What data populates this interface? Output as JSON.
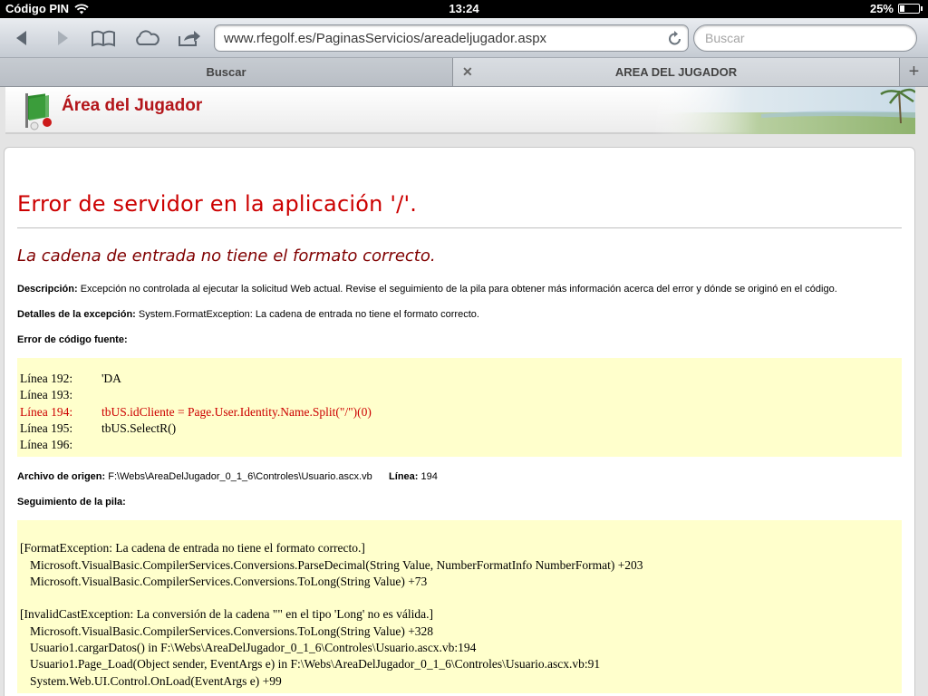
{
  "status_bar": {
    "carrier": "Código PIN",
    "time": "13:24",
    "battery": "25%",
    "battery_level": 0.25
  },
  "toolbar": {
    "url": "www.rfegolf.es/PaginasServicios/areadeljugador.aspx",
    "search_placeholder": "Buscar"
  },
  "tabs": [
    {
      "label": "Buscar",
      "active": false
    },
    {
      "label": "AREA DEL JUGADOR",
      "active": true
    }
  ],
  "banner": {
    "title": "Área del Jugador"
  },
  "error": {
    "heading": "Error de servidor en la aplicación '/'.",
    "message": "La cadena de entrada no tiene el formato correcto.",
    "description_label": "Descripción:",
    "description_text": "Excepción no controlada al ejecutar la solicitud Web actual. Revise el seguimiento de la pila para obtener más información acerca del error y dónde se originó en el código.",
    "exception_label": "Detalles de la excepción:",
    "exception_text": "System.FormatException: La cadena de entrada no tiene el formato correcto.",
    "source_label": "Error de código fuente:",
    "source_lines": [
      {
        "num": "Línea 192:",
        "code": "'DA",
        "highlight": false
      },
      {
        "num": "Línea 193:",
        "code": "",
        "highlight": false
      },
      {
        "num": "Línea 194:",
        "code": "tbUS.idCliente = Page.User.Identity.Name.Split(\"/\")(0)",
        "highlight": true
      },
      {
        "num": "Línea 195:",
        "code": "tbUS.SelectR()",
        "highlight": false
      },
      {
        "num": "Línea 196:",
        "code": "",
        "highlight": false
      }
    ],
    "file_label": "Archivo de origen:",
    "file_path": "F:\\Webs\\AreaDelJugador_0_1_6\\Controles\\Usuario.ascx.vb",
    "line_label": "Línea:",
    "line_number": "194",
    "stack_label": "Seguimiento de la pila:",
    "stack_lines": [
      {
        "text": "[FormatException: La cadena de entrada no tiene el formato correcto.]",
        "indent": false
      },
      {
        "text": "Microsoft.VisualBasic.CompilerServices.Conversions.ParseDecimal(String Value, NumberFormatInfo NumberFormat) +203",
        "indent": true
      },
      {
        "text": "Microsoft.VisualBasic.CompilerServices.Conversions.ToLong(String Value) +73",
        "indent": true
      },
      {
        "text": "",
        "indent": false
      },
      {
        "text": "[InvalidCastException: La conversión de la cadena \"\" en el tipo 'Long' no es válida.]",
        "indent": false
      },
      {
        "text": "Microsoft.VisualBasic.CompilerServices.Conversions.ToLong(String Value) +328",
        "indent": true
      },
      {
        "text": "Usuario1.cargarDatos() in F:\\Webs\\AreaDelJugador_0_1_6\\Controles\\Usuario.ascx.vb:194",
        "indent": true
      },
      {
        "text": "Usuario1.Page_Load(Object sender, EventArgs e) in F:\\Webs\\AreaDelJugador_0_1_6\\Controles\\Usuario.ascx.vb:91",
        "indent": true
      },
      {
        "text": "System.Web.UI.Control.OnLoad(EventArgs e) +99",
        "indent": true
      }
    ]
  },
  "colors": {
    "error_red": "#cc0000",
    "message_maroon": "#800000",
    "code_bg": "#ffffcc",
    "banner_red": "#b3151a"
  }
}
